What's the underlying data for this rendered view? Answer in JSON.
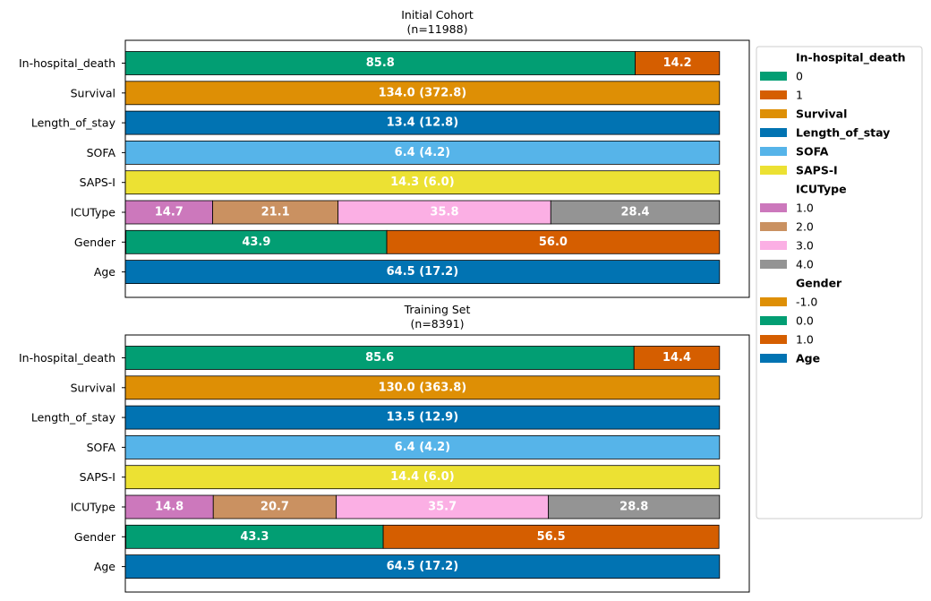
{
  "colors": {
    "green": "#029E73",
    "vermillion": "#D55E00",
    "orange": "#DE8F05",
    "blue": "#0173B2",
    "skyblue": "#56B4E9",
    "yellow": "#ECE133",
    "pink": "#CC78BC",
    "tan": "#CA9161",
    "lightpink": "#FBAFE4",
    "grey": "#949494"
  },
  "legend": [
    {
      "header": "In-hospital_death",
      "items": [
        {
          "label": "0",
          "color": "green"
        },
        {
          "label": "1",
          "color": "vermillion"
        }
      ]
    },
    {
      "header": "Survival",
      "swatch": "orange",
      "items": []
    },
    {
      "header": "Length_of_stay",
      "swatch": "blue",
      "items": []
    },
    {
      "header": "SOFA",
      "swatch": "skyblue",
      "items": []
    },
    {
      "header": "SAPS-I",
      "swatch": "yellow",
      "items": []
    },
    {
      "header": "ICUType",
      "items": [
        {
          "label": "1.0",
          "color": "pink"
        },
        {
          "label": "2.0",
          "color": "tan"
        },
        {
          "label": "3.0",
          "color": "lightpink"
        },
        {
          "label": "4.0",
          "color": "grey"
        }
      ]
    },
    {
      "header": "Gender",
      "items": [
        {
          "label": "-1.0",
          "color": "orange"
        },
        {
          "label": "0.0",
          "color": "green"
        },
        {
          "label": "1.0",
          "color": "vermillion"
        }
      ]
    },
    {
      "header": "Age",
      "swatch": "blue",
      "items": []
    }
  ],
  "chart_data": [
    {
      "type": "bar",
      "orientation": "horizontal-stacked",
      "title": "Initial Cohort\n(n=11988)",
      "xlim": [
        0,
        105
      ],
      "rows": [
        {
          "label": "In-hospital_death",
          "segments": [
            {
              "value": 85.8,
              "text": "85.8",
              "color": "green"
            },
            {
              "value": 14.2,
              "text": "14.2",
              "color": "vermillion"
            }
          ]
        },
        {
          "label": "Survival",
          "segments": [
            {
              "value": 100,
              "text": "134.0 (372.8)",
              "color": "orange"
            }
          ]
        },
        {
          "label": "Length_of_stay",
          "segments": [
            {
              "value": 100,
              "text": "13.4 (12.8)",
              "color": "blue"
            }
          ]
        },
        {
          "label": "SOFA",
          "segments": [
            {
              "value": 100,
              "text": "6.4 (4.2)",
              "color": "skyblue"
            }
          ]
        },
        {
          "label": "SAPS-I",
          "segments": [
            {
              "value": 100,
              "text": "14.3 (6.0)",
              "color": "yellow"
            }
          ]
        },
        {
          "label": "ICUType",
          "segments": [
            {
              "value": 14.7,
              "text": "14.7",
              "color": "pink"
            },
            {
              "value": 21.1,
              "text": "21.1",
              "color": "tan"
            },
            {
              "value": 35.8,
              "text": "35.8",
              "color": "lightpink"
            },
            {
              "value": 28.4,
              "text": "28.4",
              "color": "grey"
            }
          ]
        },
        {
          "label": "Gender",
          "segments": [
            {
              "value": 0.1,
              "text": "",
              "color": "orange"
            },
            {
              "value": 43.9,
              "text": "43.9",
              "color": "green"
            },
            {
              "value": 56.0,
              "text": "56.0",
              "color": "vermillion"
            }
          ]
        },
        {
          "label": "Age",
          "segments": [
            {
              "value": 100,
              "text": "64.5 (17.2)",
              "color": "blue"
            }
          ]
        }
      ]
    },
    {
      "type": "bar",
      "orientation": "horizontal-stacked",
      "title": "Training Set\n(n=8391)",
      "xlim": [
        0,
        105
      ],
      "rows": [
        {
          "label": "In-hospital_death",
          "segments": [
            {
              "value": 85.6,
              "text": "85.6",
              "color": "green"
            },
            {
              "value": 14.4,
              "text": "14.4",
              "color": "vermillion"
            }
          ]
        },
        {
          "label": "Survival",
          "segments": [
            {
              "value": 100,
              "text": "130.0 (363.8)",
              "color": "orange"
            }
          ]
        },
        {
          "label": "Length_of_stay",
          "segments": [
            {
              "value": 100,
              "text": "13.5 (12.9)",
              "color": "blue"
            }
          ]
        },
        {
          "label": "SOFA",
          "segments": [
            {
              "value": 100,
              "text": "6.4 (4.2)",
              "color": "skyblue"
            }
          ]
        },
        {
          "label": "SAPS-I",
          "segments": [
            {
              "value": 100,
              "text": "14.4 (6.0)",
              "color": "yellow"
            }
          ]
        },
        {
          "label": "ICUType",
          "segments": [
            {
              "value": 14.8,
              "text": "14.8",
              "color": "pink"
            },
            {
              "value": 20.7,
              "text": "20.7",
              "color": "tan"
            },
            {
              "value": 35.7,
              "text": "35.7",
              "color": "lightpink"
            },
            {
              "value": 28.8,
              "text": "28.8",
              "color": "grey"
            }
          ]
        },
        {
          "label": "Gender",
          "segments": [
            {
              "value": 0.1,
              "text": "",
              "color": "orange"
            },
            {
              "value": 43.3,
              "text": "43.3",
              "color": "green"
            },
            {
              "value": 56.5,
              "text": "56.5",
              "color": "vermillion"
            }
          ]
        },
        {
          "label": "Age",
          "segments": [
            {
              "value": 100,
              "text": "64.5 (17.2)",
              "color": "blue"
            }
          ]
        }
      ]
    }
  ]
}
